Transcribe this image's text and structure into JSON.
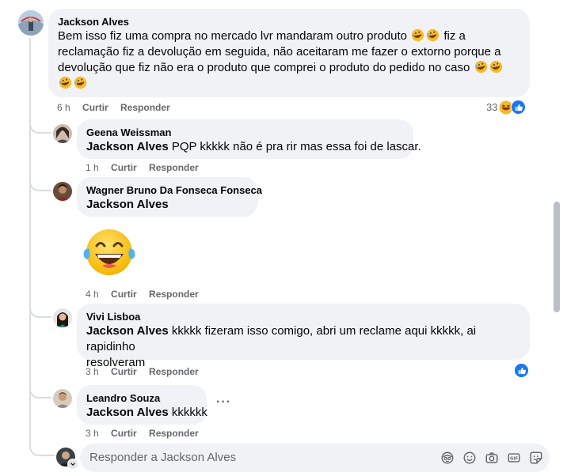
{
  "main_comment": {
    "author": "Jackson Alves",
    "text_line1": "Bem isso fiz uma compra no mercado lvr mandaram outro produto",
    "text_line1_after": "fiz a",
    "text_line2": "reclamação fiz a devolução em seguida, não aceitaram me fazer o extorno porque a",
    "text_line3": "devolução que fiz não era o produto que comprei o produto do pedido no caso",
    "time": "6 h",
    "like_label": "Curtir",
    "reply_label": "Responder",
    "reaction_count": "33"
  },
  "replies": [
    {
      "author": "Geena Weissman",
      "mention": "Jackson Alves",
      "text": " PQP kkkkk não é pra rir mas essa foi de lascar.",
      "time": "1 h",
      "like_label": "Curtir",
      "reply_label": "Responder"
    },
    {
      "author": "Wagner Bruno Da Fonseca Fonseca",
      "mention": "Jackson Alves",
      "time": "4 h",
      "like_label": "Curtir",
      "reply_label": "Responder",
      "sticker": "laughing-tears-emoji"
    },
    {
      "author": "Vivi Lisboa",
      "mention": "Jackson Alves",
      "text_line1": " kkkkk fizeram isso comigo, abri um reclame aqui kkkkk, ai rapidinho",
      "text_line2": "resolveram",
      "time": "3 h",
      "like_label": "Curtir",
      "reply_label": "Responder"
    },
    {
      "author": "Leandro Souza",
      "mention": "Jackson Alves",
      "text": " kkkkkk",
      "time": "3 h",
      "like_label": "Curtir",
      "reply_label": "Responder",
      "more_label": "···"
    }
  ],
  "composer": {
    "placeholder": "Responder a Jackson Alves",
    "icons": [
      "avatar-sticker-icon",
      "emoji-icon",
      "camera-icon",
      "gif-icon",
      "sticker-icon"
    ]
  },
  "colors": {
    "bubble": "#f0f2f5",
    "meta": "#65676b",
    "like_blue": "#1877f2"
  }
}
